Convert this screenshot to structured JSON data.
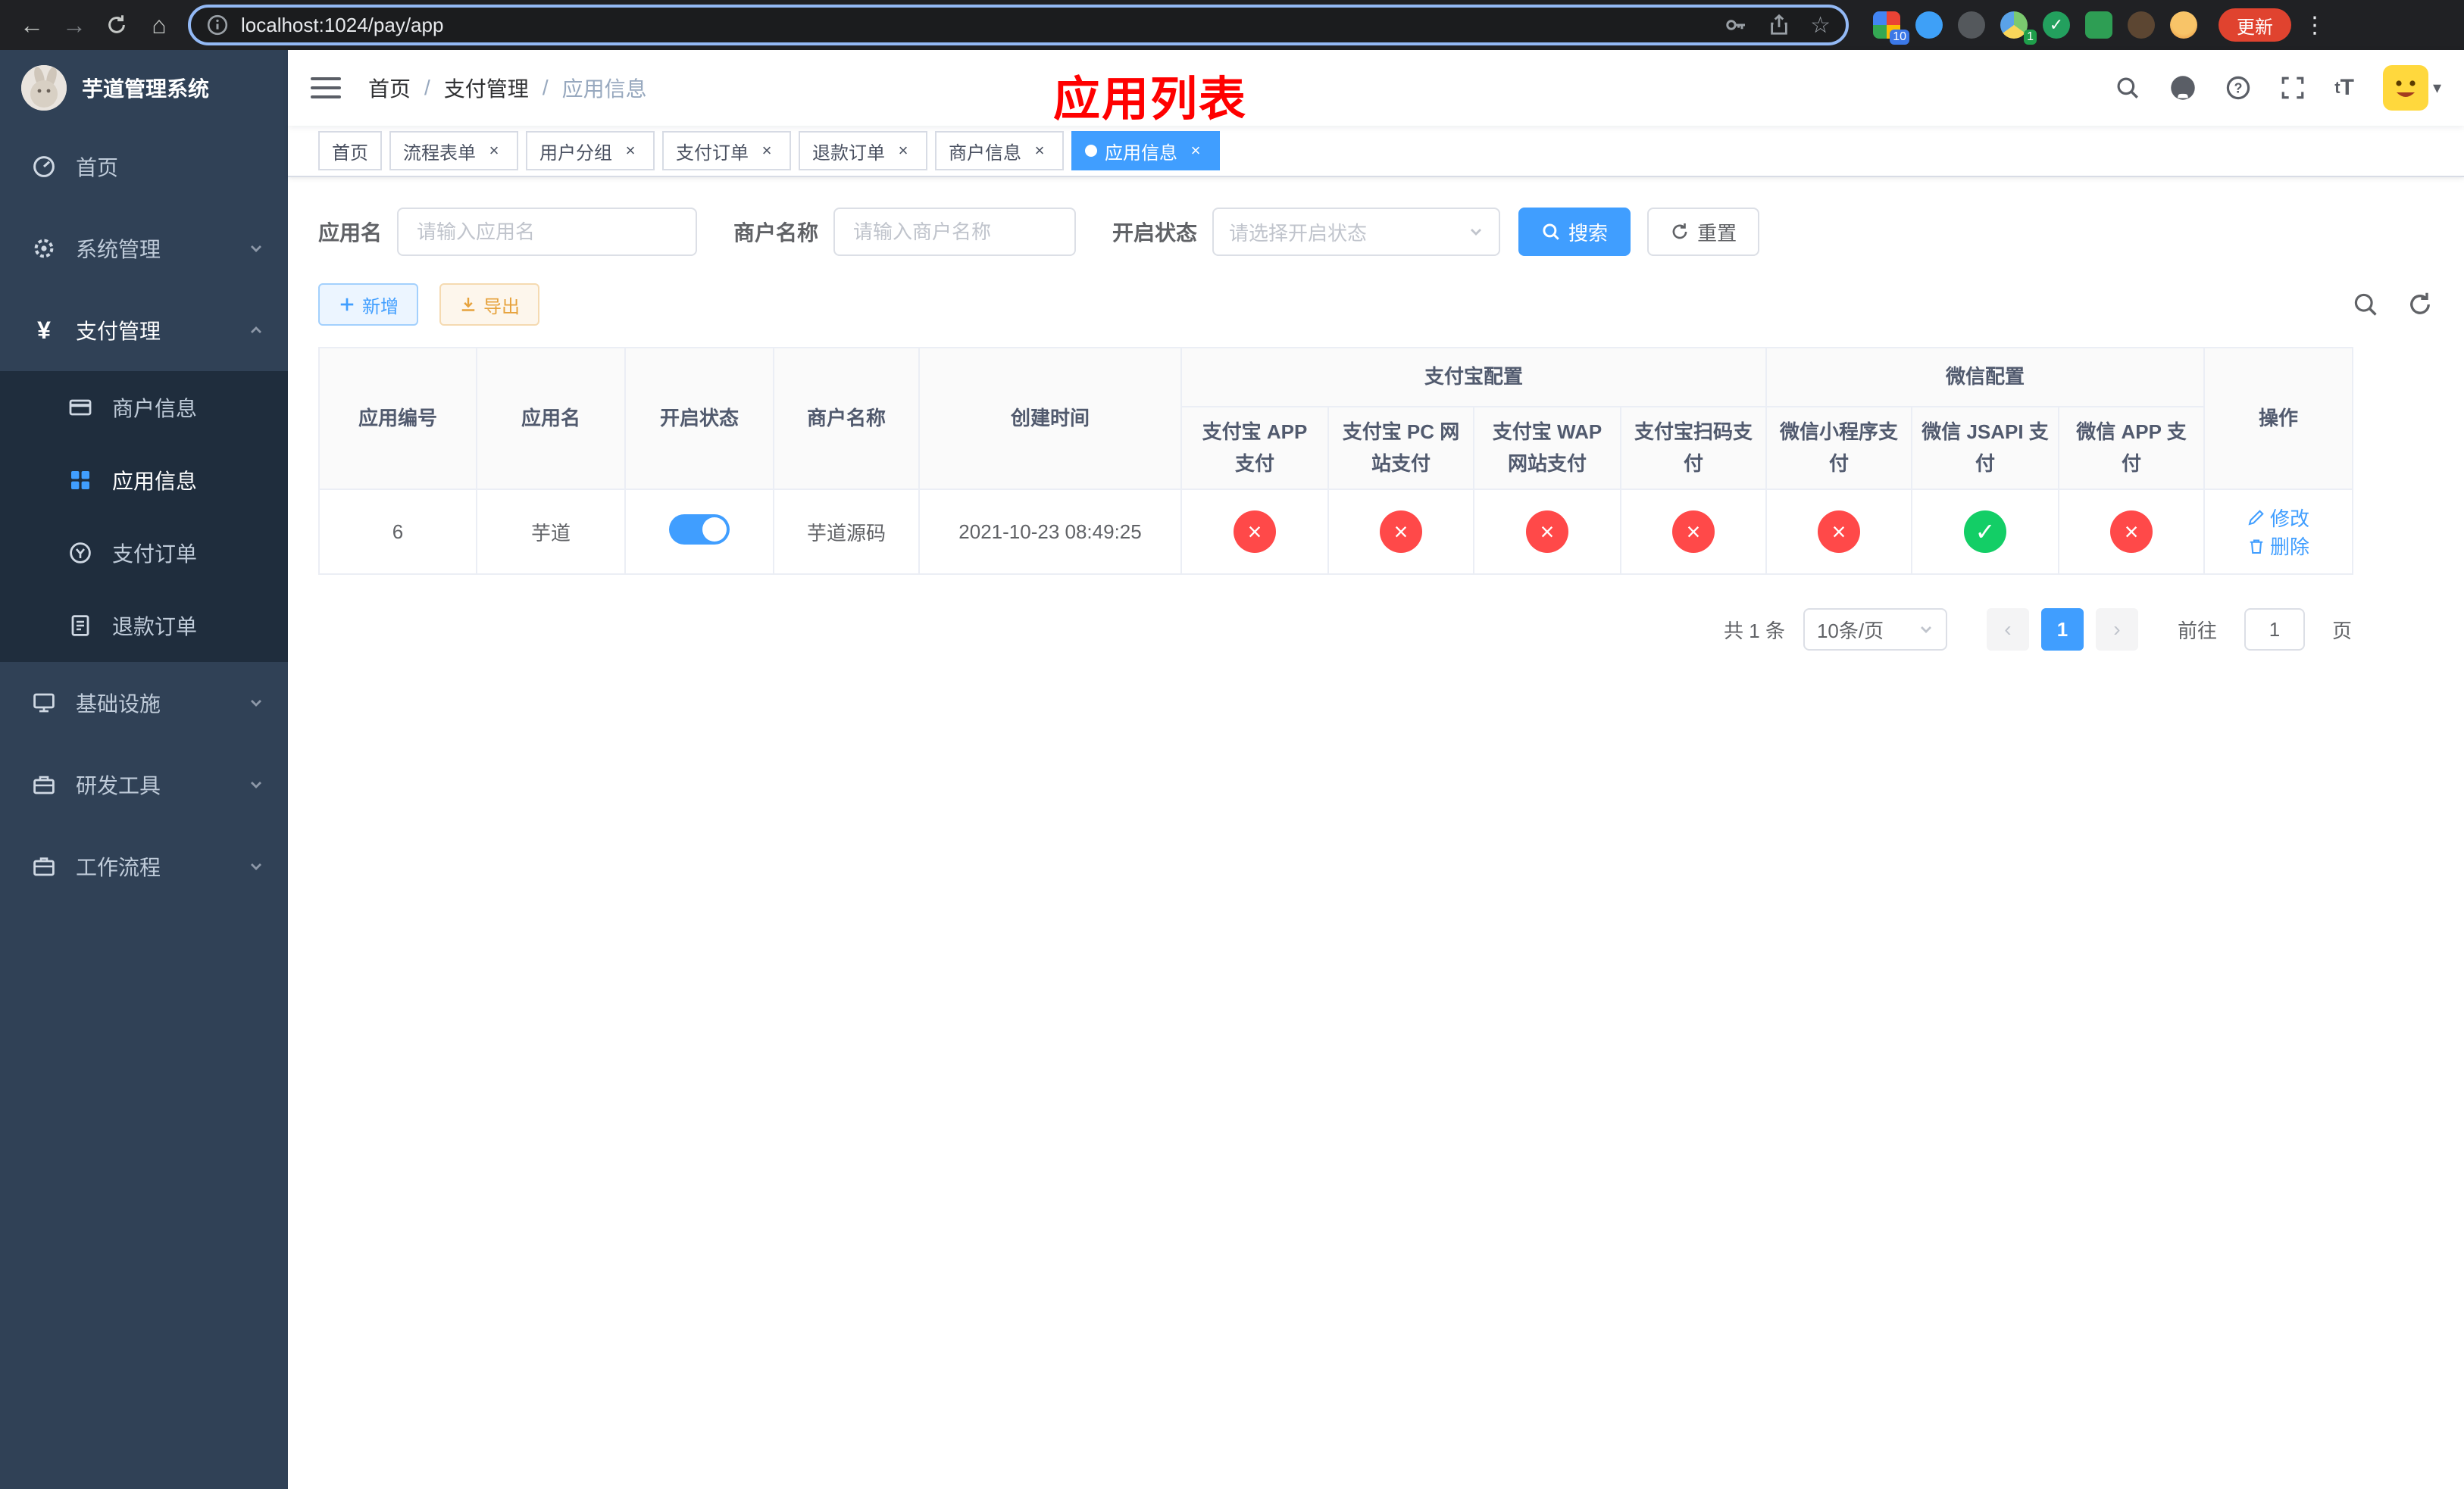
{
  "browser": {
    "url": "localhost:1024/pay/app",
    "update_button": "更新",
    "extension_badge": "10",
    "extension_badge_green": "1"
  },
  "sidebar": {
    "app_title": "芋道管理系统",
    "items": [
      {
        "label": "首页"
      },
      {
        "label": "系统管理"
      },
      {
        "label": "支付管理"
      },
      {
        "label": "商户信息"
      },
      {
        "label": "应用信息"
      },
      {
        "label": "支付订单"
      },
      {
        "label": "退款订单"
      },
      {
        "label": "基础设施"
      },
      {
        "label": "研发工具"
      },
      {
        "label": "工作流程"
      }
    ]
  },
  "header": {
    "breadcrumb": {
      "home": "首页",
      "section": "支付管理",
      "current": "应用信息"
    },
    "separator": "/",
    "page_title": "应用列表"
  },
  "tabs": [
    {
      "label": "首页"
    },
    {
      "label": "流程表单"
    },
    {
      "label": "用户分组"
    },
    {
      "label": "支付订单"
    },
    {
      "label": "退款订单"
    },
    {
      "label": "商户信息"
    },
    {
      "label": "应用信息"
    }
  ],
  "filters": {
    "app_name_label": "应用名",
    "app_name_placeholder": "请输入应用名",
    "merchant_label": "商户名称",
    "merchant_placeholder": "请输入商户名称",
    "status_label": "开启状态",
    "status_placeholder": "请选择开启状态",
    "search_button": "搜索",
    "reset_button": "重置"
  },
  "toolbar": {
    "add_button": "新增",
    "export_button": "导出"
  },
  "table": {
    "groups": {
      "alipay": "支付宝配置",
      "wechat": "微信配置"
    },
    "columns": {
      "id": "应用编号",
      "name": "应用名",
      "status": "开启状态",
      "merchant": "商户名称",
      "created": "创建时间",
      "alipay_app": "支付宝 APP 支付",
      "alipay_pc": "支付宝 PC 网站支付",
      "alipay_wap": "支付宝 WAP 网站支付",
      "alipay_qr": "支付宝扫码支付",
      "wx_lite": "微信小程序支付",
      "wx_jsapi": "微信 JSAPI 支付",
      "wx_app": "微信 APP 支付",
      "actions": "操作"
    },
    "rows": [
      {
        "id": "6",
        "name": "芋道",
        "enabled": true,
        "merchant": "芋道源码",
        "created": "2021-10-23 08:49:25",
        "config": {
          "alipay_app": false,
          "alipay_pc": false,
          "alipay_wap": false,
          "alipay_qr": false,
          "wx_lite": false,
          "wx_jsapi": true,
          "wx_app": false
        },
        "edit": "修改",
        "delete": "删除"
      }
    ]
  },
  "pagination": {
    "total": "共 1 条",
    "page_size": "10条/页",
    "page": "1",
    "goto_label": "前往",
    "goto_value": "1",
    "goto_suffix": "页"
  },
  "colors": {
    "primary": "#409eff",
    "enabled_green": "#13ce66",
    "disabled_red": "#ff4949",
    "page_title_red": "#ff0000",
    "sidebar_bg": "#304156",
    "submenu_bg": "#1f2d3d"
  }
}
